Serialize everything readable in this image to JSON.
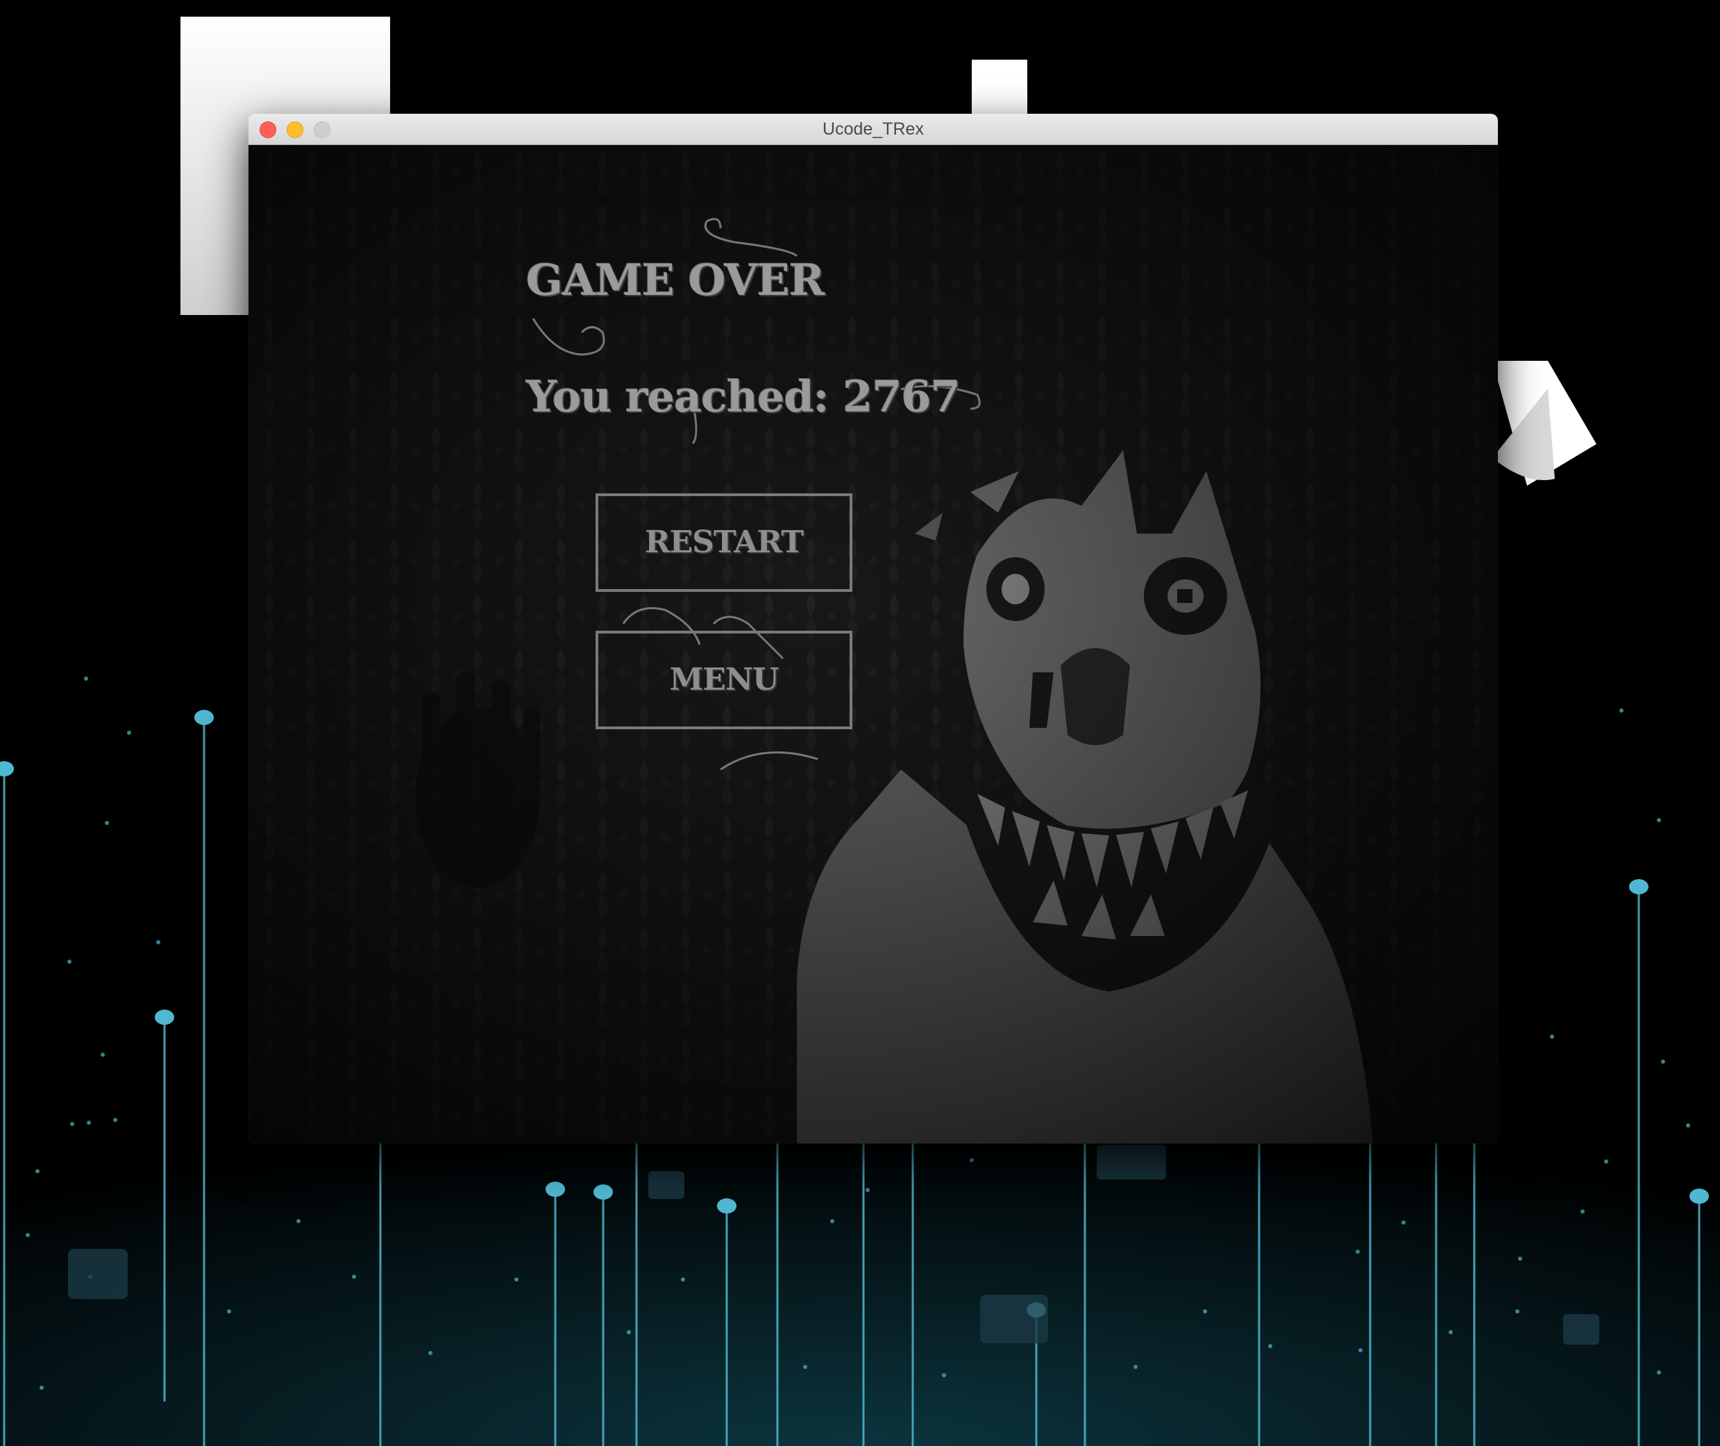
{
  "desktop": {
    "wallpaper_colors": {
      "background": "#000000",
      "accent": "#4fb8d0",
      "text": "#ffffff"
    }
  },
  "window": {
    "title": "Ucode_TRex",
    "traffic_lights": [
      "close",
      "minimize",
      "zoom"
    ]
  },
  "game": {
    "title": "GAME OVER",
    "score_label": "You reached: 2767",
    "score": 2767,
    "restart_label": "RESTART",
    "menu_label": "MENU",
    "colors": {
      "background": "#141414",
      "text": "#9a9a9a",
      "button_border": "#7a7a7a",
      "figure": "#6e6e6e"
    }
  }
}
